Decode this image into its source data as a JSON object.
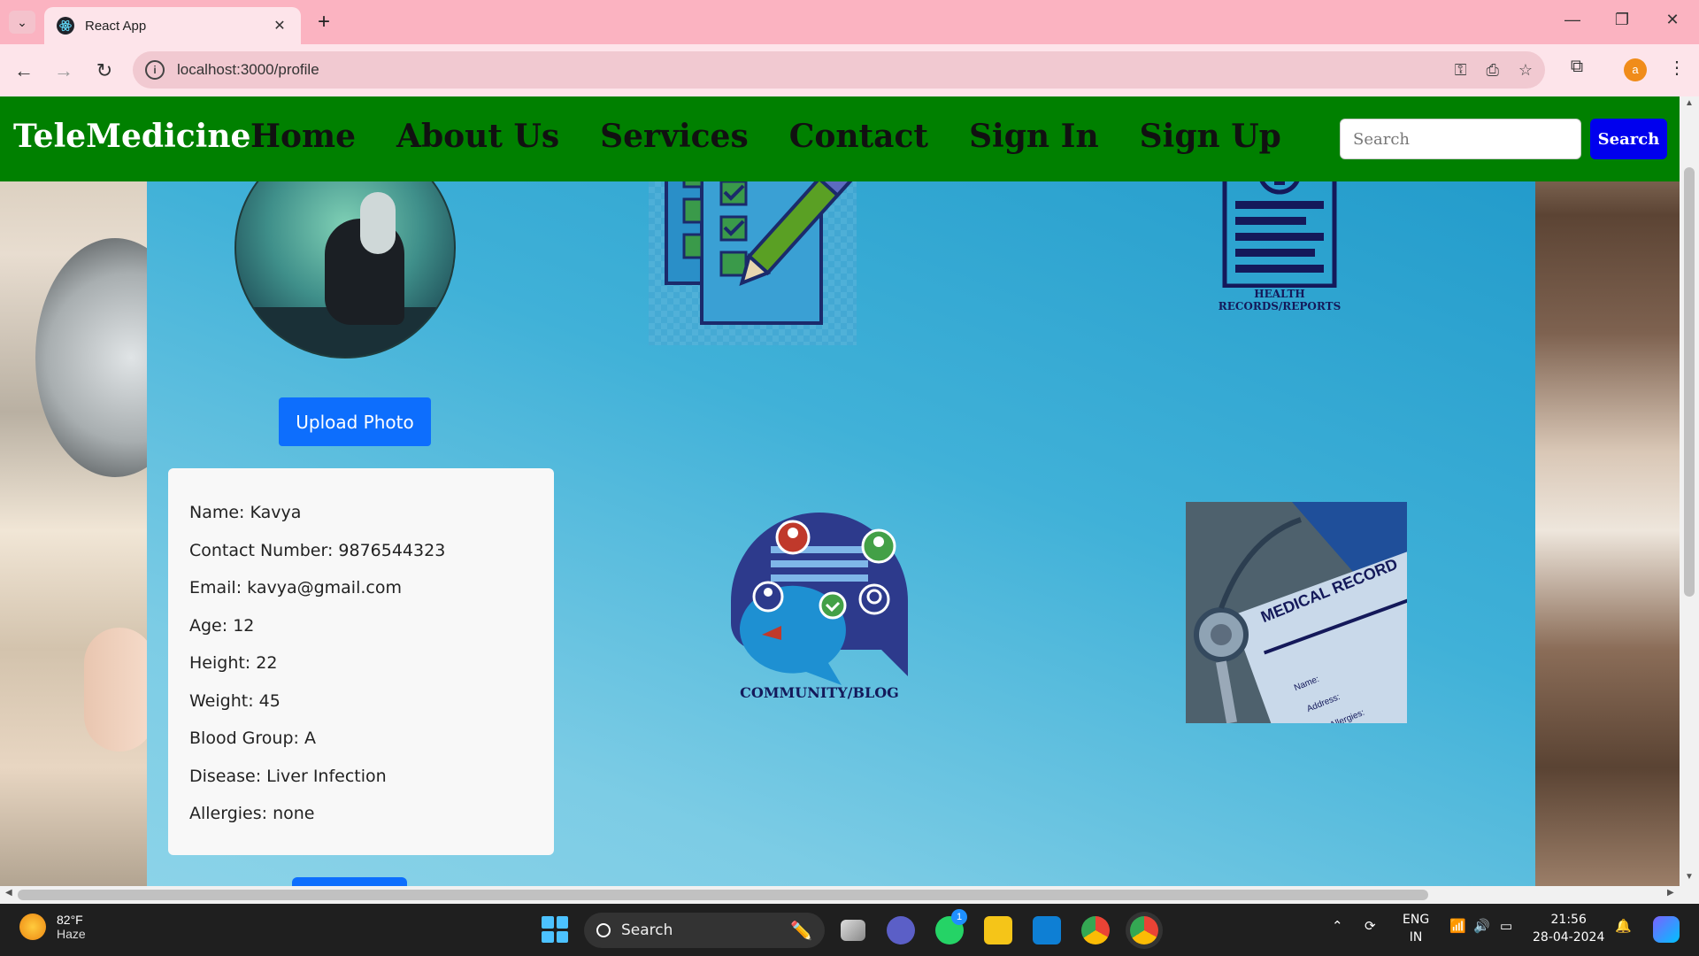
{
  "browser": {
    "tab_title": "React App",
    "url": "localhost:3000/profile",
    "profile_initial": "a"
  },
  "navbar": {
    "brand": "TeleMedicine",
    "links": [
      "Home",
      "About Us",
      "Services",
      "Contact",
      "Sign In",
      "Sign Up"
    ],
    "search_placeholder": "Search",
    "search_button": "Search"
  },
  "profile": {
    "upload_button": "Upload Photo",
    "fields": [
      "Name: Kavya",
      "Contact Number: 9876544323",
      "Email: kavya@gmail.com",
      "Age: 12",
      "Height: 22",
      "Weight: 45",
      "Blood Group: A",
      "Disease: Liver Infection",
      "Allergies: none"
    ]
  },
  "tiles": {
    "health_records_caption_line1": "HEALTH",
    "health_records_caption_line2": "RECORDS/REPORTS",
    "community_caption": "COMMUNITY/BLOG",
    "medical_record_text": "MEDICAL RECORD",
    "medical_record_name": "Name:",
    "medical_record_address": "Address:",
    "medical_record_allergies": "Allergies:"
  },
  "taskbar": {
    "weather_temp": "82°F",
    "weather_desc": "Haze",
    "search_label": "Search",
    "whatsapp_badge": "1",
    "lang_line1": "ENG",
    "lang_line2": "IN",
    "time": "21:56",
    "date": "28-04-2024"
  },
  "colors": {
    "navbar_bg": "#008000",
    "search_button_bg": "#0000ee",
    "upload_button_bg": "#0d6efd",
    "chrome_tab_bar": "#fbb3c1"
  }
}
